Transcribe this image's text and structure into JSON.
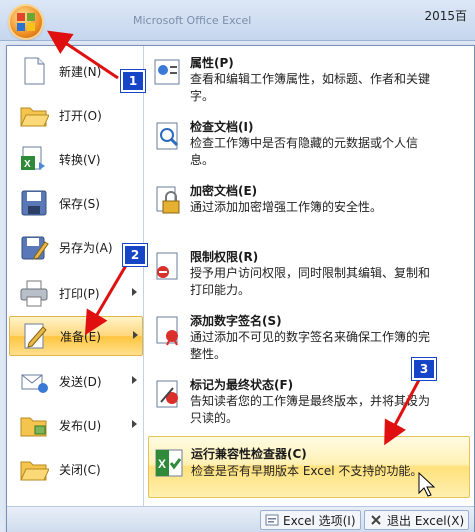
{
  "window": {
    "title_year": "2015百",
    "title_blurred": "Microsoft Office Excel"
  },
  "left_menu": [
    {
      "label": "新建(N)",
      "icon": "new-doc-icon"
    },
    {
      "label": "打开(O)",
      "icon": "open-folder-icon"
    },
    {
      "label": "转换(V)",
      "icon": "convert-icon"
    },
    {
      "label": "保存(S)",
      "icon": "save-icon"
    },
    {
      "label": "另存为(A)",
      "icon": "save-as-icon"
    },
    {
      "label": "打印(P)",
      "icon": "print-icon"
    },
    {
      "label": "准备(E)",
      "icon": "prepare-icon"
    },
    {
      "label": "发送(D)",
      "icon": "send-icon"
    },
    {
      "label": "发布(U)",
      "icon": "publish-icon"
    },
    {
      "label": "关闭(C)",
      "icon": "close-folder-icon"
    }
  ],
  "right_menu": [
    {
      "title": "属性(P)",
      "desc": "查看和编辑工作簿属性，如标题、作者和关键字。"
    },
    {
      "title": "检查文档(I)",
      "desc": "检查工作簿中是否有隐藏的元数据或个人信息。"
    },
    {
      "title": "加密文档(E)",
      "desc": "通过添加加密增强工作簿的安全性。"
    },
    {
      "title": "限制权限(R)",
      "desc": "授予用户访问权限，同时限制其编辑、复制和打印能力。"
    },
    {
      "title": "添加数字签名(S)",
      "desc": "通过添加不可见的数字签名来确保工作簿的完整性。"
    },
    {
      "title": "标记为最终状态(F)",
      "desc": "告知读者您的工作簿是最终版本，并将其设为只读的。"
    },
    {
      "title": "运行兼容性检查器(C)",
      "desc": "检查是否有早期版本 Excel 不支持的功能。"
    }
  ],
  "bottom": {
    "options_label": "Excel 选项(I)",
    "exit_label": "退出 Excel(X)"
  },
  "badges": [
    "1",
    "2",
    "3"
  ],
  "colors": {
    "highlight": "#ffd67a",
    "badge": "#1645c8",
    "arrow": "#e01010"
  }
}
